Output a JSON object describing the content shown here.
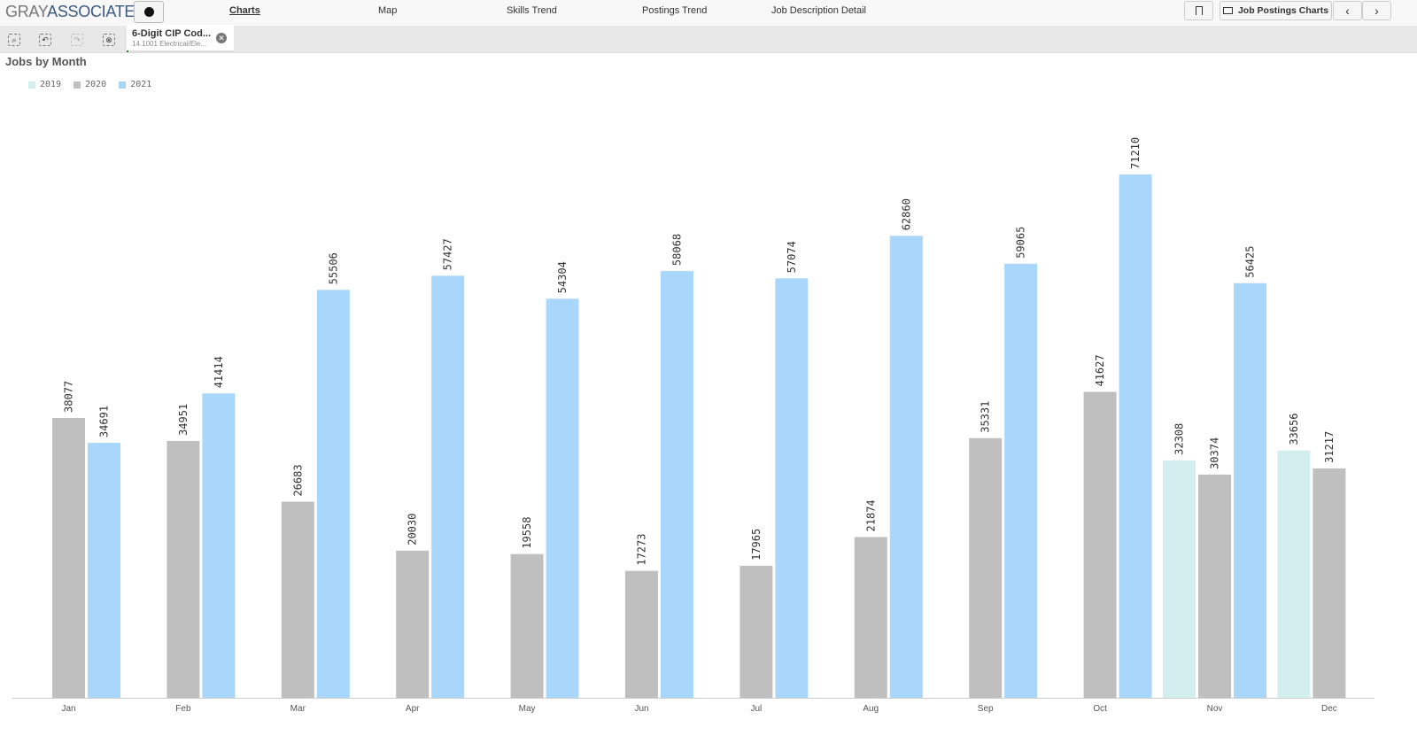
{
  "header": {
    "logo_part1": "GRAY",
    "logo_part2": "ASSOCIATES",
    "more_icon": "more-dots-icon",
    "nav": [
      "Charts",
      "Map",
      "Skills Trend",
      "Postings Trend",
      "Job Description Detail"
    ],
    "active_nav": "Charts",
    "bookmark_icon": "bookmark-icon",
    "sheet_button": "Job Postings Charts",
    "prev_icon": "chevron-left-icon",
    "next_icon": "chevron-right-icon"
  },
  "selections": {
    "tools": [
      "search-selection-icon",
      "step-back-icon",
      "step-forward-icon",
      "clear-selections-icon"
    ],
    "chip_title": "6-Digit CIP Cod...",
    "chip_value": "14.1001 Electrical/Ele..."
  },
  "chart_data": {
    "type": "bar",
    "title": "Jobs by Month",
    "categories": [
      "Jan",
      "Feb",
      "Mar",
      "Apr",
      "May",
      "Jun",
      "Jul",
      "Aug",
      "Sep",
      "Oct",
      "Nov",
      "Dec"
    ],
    "series": [
      {
        "name": "2019",
        "color": "#d3eeee",
        "values": [
          null,
          null,
          null,
          null,
          null,
          null,
          null,
          null,
          null,
          null,
          32308,
          33656
        ]
      },
      {
        "name": "2020",
        "color": "#bfbfbf",
        "values": [
          38077,
          34951,
          26683,
          20030,
          19558,
          17273,
          17965,
          21874,
          35331,
          41627,
          30374,
          31217
        ]
      },
      {
        "name": "2021",
        "color": "#a8d7fb",
        "values": [
          34691,
          41414,
          55506,
          57427,
          54304,
          58068,
          57074,
          62860,
          59065,
          71210,
          56425,
          null
        ]
      }
    ],
    "ylim": [
      0,
      80000
    ],
    "legend": "top-left",
    "grid": false,
    "data_labels": true
  }
}
